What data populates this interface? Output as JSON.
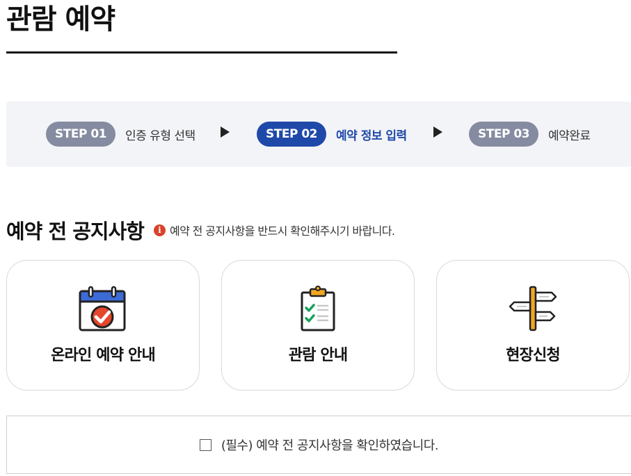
{
  "page": {
    "title": "관람 예약"
  },
  "steps": [
    {
      "badge": "STEP 01",
      "label": "인증 유형 선택",
      "active": false
    },
    {
      "badge": "STEP 02",
      "label": "예약 정보 입력",
      "active": true
    },
    {
      "badge": "STEP 03",
      "label": "예약완료",
      "active": false
    }
  ],
  "notice": {
    "title": "예약 전 공지사항",
    "info_glyph": "i",
    "subtitle": "예약 전 공지사항을 반드시 확인해주시기 바랍니다."
  },
  "cards": [
    {
      "label": "온라인 예약 안내",
      "icon": "calendar-check-icon"
    },
    {
      "label": "관람 안내",
      "icon": "clipboard-checklist-icon"
    },
    {
      "label": "현장신청",
      "icon": "signpost-icon"
    }
  ],
  "confirm": {
    "label": "(필수) 예약 전 공지사항을 확인하였습니다.",
    "checked": false
  },
  "colors": {
    "active_step": "#1f49a9",
    "inactive_step": "#858ba0",
    "info_icon": "#d9412b",
    "steps_bg": "#f3f4f8"
  }
}
